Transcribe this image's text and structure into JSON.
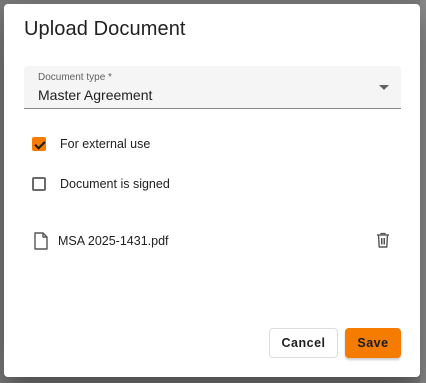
{
  "dialog": {
    "title": "Upload Document"
  },
  "document_type": {
    "label": "Document type *",
    "value": "Master Agreement",
    "arrow_icon": "dropdown-arrow-icon"
  },
  "options": {
    "external_use": {
      "label": "For external use",
      "checked": true
    },
    "signed": {
      "label": "Document is signed",
      "checked": false
    }
  },
  "file": {
    "name": "MSA 2025-1431.pdf",
    "icon": "document-icon",
    "delete_icon": "trash-icon"
  },
  "actions": {
    "cancel_label": "Cancel",
    "save_label": "Save"
  },
  "colors": {
    "accent": "#f57c00",
    "field_background": "#f5f5f5",
    "overlay": "#7a7a7a"
  }
}
